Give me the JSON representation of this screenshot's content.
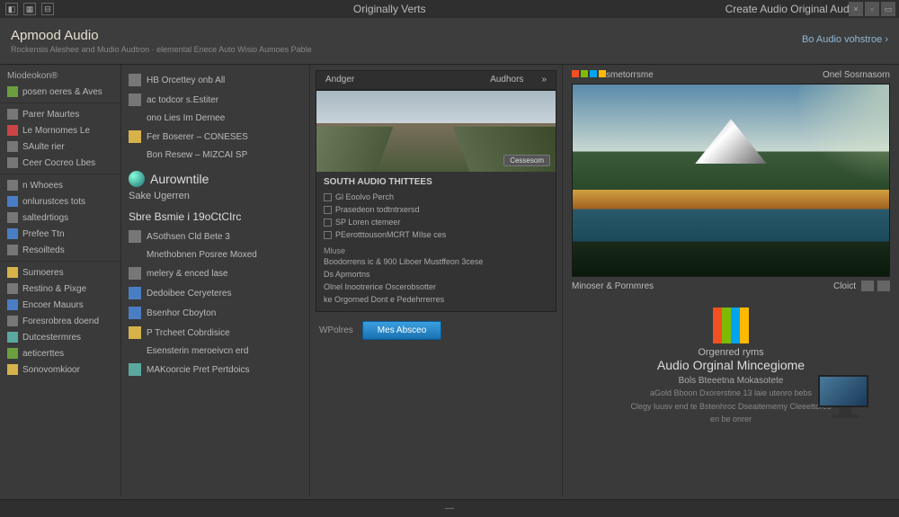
{
  "titlebar": {
    "center": "Originally Verts",
    "right": "Create Audio Original Audio"
  },
  "header": {
    "app": "Apmood Audio",
    "sub": "Rockensis Aleshee and Mudio Audtron · elemental Enece Auto Wisio Aumoes Pable",
    "rightlink": "Bo Audio vohstroe"
  },
  "sidebar": {
    "heading1": "Miodeokon®",
    "items": [
      {
        "icon": "ico-green",
        "label": "posen oeres & Aves"
      },
      {
        "icon": "ico-gray",
        "label": "Parer Maurtes"
      },
      {
        "icon": "ico-red",
        "label": "Le Mornomes Le"
      },
      {
        "icon": "ico-gray",
        "label": "SAulte rier"
      },
      {
        "icon": "ico-gray",
        "label": "Ceer Cocreo Lbes"
      },
      {
        "icon": "ico-gray",
        "label": "n Whoees"
      },
      {
        "icon": "ico-blue",
        "label": "onlurustces tots"
      },
      {
        "icon": "ico-gray",
        "label": "saltedrtiogs"
      },
      {
        "icon": "ico-blue",
        "label": "Prefee Ttn"
      },
      {
        "icon": "ico-gray",
        "label": "Resoilteds"
      },
      {
        "icon": "ico-yellow",
        "label": "Sumoeres"
      },
      {
        "icon": "ico-gray",
        "label": "Restino & Pixge"
      },
      {
        "icon": "ico-blue",
        "label": "Encoer Mauurs"
      },
      {
        "icon": "ico-gray",
        "label": "Foresrobrea doend"
      },
      {
        "icon": "ico-teal",
        "label": "Dutcestermres"
      },
      {
        "icon": "ico-green",
        "label": "aeticerttes"
      },
      {
        "icon": "ico-yellow",
        "label": "Sonovomkioor"
      }
    ]
  },
  "midcol": {
    "rows1": [
      {
        "icon": "ico-gray",
        "label": "HB Orcettey onb All"
      },
      {
        "icon": "ico-gray",
        "label": "ac todcor s.Estiter"
      },
      {
        "icon": "",
        "label": "ono Lies Im Dernee"
      },
      {
        "icon": "ico-yellow",
        "label": "Fer Boserer – CONESES"
      },
      {
        "icon": "",
        "label": "Bon Resew – MIZCAI SP"
      }
    ],
    "section_title": "Aurowntile",
    "section_sub": "Sake Ugerren",
    "section2_title": "Sbre Bsmie i 19oCtCIrc",
    "rows2": [
      {
        "icon": "ico-gray",
        "label": "ASothsen Cld Bete 3"
      },
      {
        "icon": "",
        "label": "Mnethobnen Posree Moxed"
      },
      {
        "icon": "ico-gray",
        "label": "melery & enced lase"
      },
      {
        "icon": "ico-blue",
        "label": "Dedoibee Ceryeteres"
      },
      {
        "icon": "ico-blue",
        "label": "Bsenhor Cboyton"
      },
      {
        "icon": "ico-yellow",
        "label": "P Trcheet Cobrdisice"
      },
      {
        "icon": "",
        "label": "Esensterin meroeivcn erd"
      },
      {
        "icon": "ico-teal",
        "label": "MAKoorcie Pret Pertdoics"
      }
    ]
  },
  "center": {
    "tab_left": "Andger",
    "tab_right": "Audhors",
    "badge": "Cessesom",
    "opts_title": "SOUTH AUDIO THITTEES",
    "opts": [
      "Gl Eoolvo Perch",
      "Prasedeon todtntrxersd",
      "SP Loren ctemeer",
      "PEerotttousonMCRT MIlse ces"
    ],
    "sect_label": "Mluse",
    "sect_rows": [
      "Boodorrens ic & 900 Liboer Mustffeon 3cese",
      "Ds Apmortns",
      "Olnel Inootrerice Oscerobsotter",
      "ke Orgorned Dont e Pedehrrerres"
    ],
    "footer_label": "WPolres",
    "button": "Mes Absceo"
  },
  "rpanel": {
    "top_left": "smetorrsme",
    "top_right": "Onel Sosrnasorn",
    "caption": "Minoser & Pornmres",
    "caption_btn": "Cloict",
    "promo_heading_small": "Orgenred ryms",
    "promo_heading": "Audio Orginal Mincegiome",
    "promo_sub": "Bols Bteeetna Mokasotete",
    "promo_lines": [
      "aGold Bboon Dxorerstine 13 laie utenro bebs",
      "Clegy luusv end te Bstenhroc Dseaitememy Cleeettores",
      "en be onrer"
    ]
  },
  "statusbar": "—"
}
